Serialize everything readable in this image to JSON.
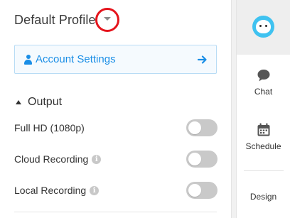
{
  "profile": {
    "title": "Default Profile",
    "dropdown_icon": "caret-down-icon",
    "highlight_color": "#e5141c"
  },
  "account_settings": {
    "label": "Account Settings",
    "icon": "user-icon",
    "arrow_icon": "arrow-right-icon",
    "accent": "#1a8ee6"
  },
  "output_section": {
    "title": "Output",
    "expanded": true,
    "settings": [
      {
        "label": "Full HD (1080p)",
        "info": false,
        "enabled": false
      },
      {
        "label": "Cloud Recording",
        "info": true,
        "enabled": false
      },
      {
        "label": "Local Recording",
        "info": true,
        "enabled": false
      }
    ]
  },
  "nav_rail": {
    "avatar_color": "#3fc2f0",
    "items": [
      {
        "label": "Chat",
        "icon": "chat-bubble-icon"
      },
      {
        "label": "Schedule",
        "icon": "calendar-icon"
      },
      {
        "label": "Design",
        "icon": "design-icon"
      }
    ]
  }
}
